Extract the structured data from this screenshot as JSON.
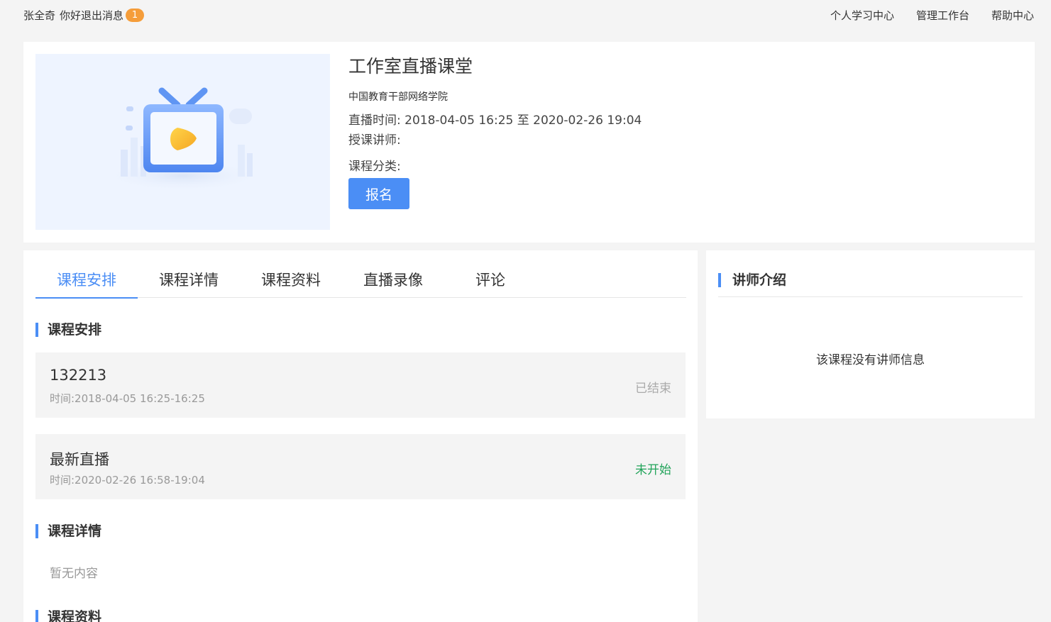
{
  "topbar": {
    "user_name": "张全奇",
    "greeting": "你好",
    "logout": "退出",
    "messages_label": "消息",
    "messages_count": "1",
    "links": [
      "个人学习中心",
      "管理工作台",
      "帮助中心"
    ]
  },
  "course": {
    "title": "工作室直播课堂",
    "org": "中国教育干部网络学院",
    "live_time_label": "直播时间:",
    "live_time_value": "2018-04-05 16:25 至 2020-02-26 19:04",
    "instructor_label": "授课讲师:",
    "category_label": "课程分类:",
    "signup_button": "报名"
  },
  "tabs": [
    "课程安排",
    "课程详情",
    "课程资料",
    "直播录像",
    "评论"
  ],
  "schedule": {
    "title": "课程安排",
    "sessions": [
      {
        "name": "132213",
        "time": "时间:2018-04-05 16:25-16:25",
        "status": "已结束"
      },
      {
        "name": "最新直播",
        "time": "时间:2020-02-26 16:58-19:04",
        "status": "未开始"
      }
    ]
  },
  "details": {
    "title": "课程详情",
    "empty": "暂无内容"
  },
  "materials": {
    "title": "课程资料"
  },
  "instructor_panel": {
    "title": "讲师介绍",
    "empty": "该课程没有讲师信息"
  },
  "colors": {
    "accent": "#4b8ef5",
    "badge": "#f59d3a",
    "pending": "#22a35a",
    "ended": "#aaaaaa"
  }
}
